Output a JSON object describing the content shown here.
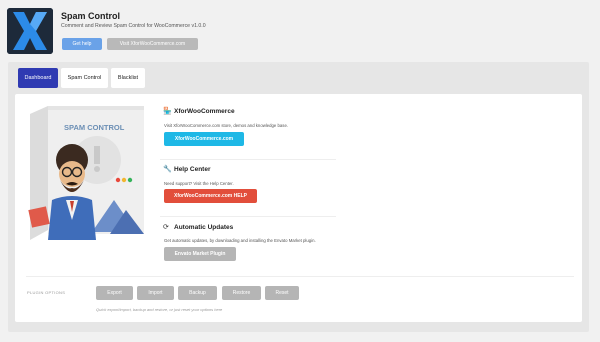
{
  "header": {
    "logo_icon": "xforwoocommerce-logo-icon",
    "title": "Spam Control",
    "subtitle": "Comment and Review Spam Control for WooCommerce v1.0.0",
    "buttons": {
      "help": "Get help",
      "site": "Visit XforWooCommerce.com"
    }
  },
  "tabs": [
    {
      "label": "Dashboard",
      "active": true
    },
    {
      "label": "Spam Control",
      "active": false
    },
    {
      "label": "Blacklist",
      "active": false
    }
  ],
  "product": {
    "box_label": "SPAM CONTROL"
  },
  "sections": {
    "xfor": {
      "icon": "shop-icon",
      "title": "XforWooCommerce",
      "desc": "Visit XforWooCommerce.com store, demos and knowledge base.",
      "button": "XforWooCommerce.com"
    },
    "help": {
      "icon": "wrench-icon",
      "title": "Help Center",
      "desc": "Need support? Visit the Help Center.",
      "button": "XforWooCommerce.com HELP"
    },
    "updates": {
      "icon": "refresh-icon",
      "title": "Automatic Updates",
      "desc": "Get automatic updates, by downloading and installing the Envato Market plugin.",
      "button": "Envato Market Plugin"
    }
  },
  "plugin_options": {
    "label": "PLUGIN OPTIONS",
    "buttons": [
      "Export",
      "Import",
      "Backup",
      "Restore",
      "Reset"
    ],
    "help": "Quick export/import, backup and restore, or just reset your options here"
  },
  "colors": {
    "tab_active": "#2f3ab2",
    "xfor_button": "#1eb8e6",
    "help_button": "#e24e3b",
    "envato_button": "#b5b5b5",
    "get_help_button": "#6aa2e8"
  }
}
